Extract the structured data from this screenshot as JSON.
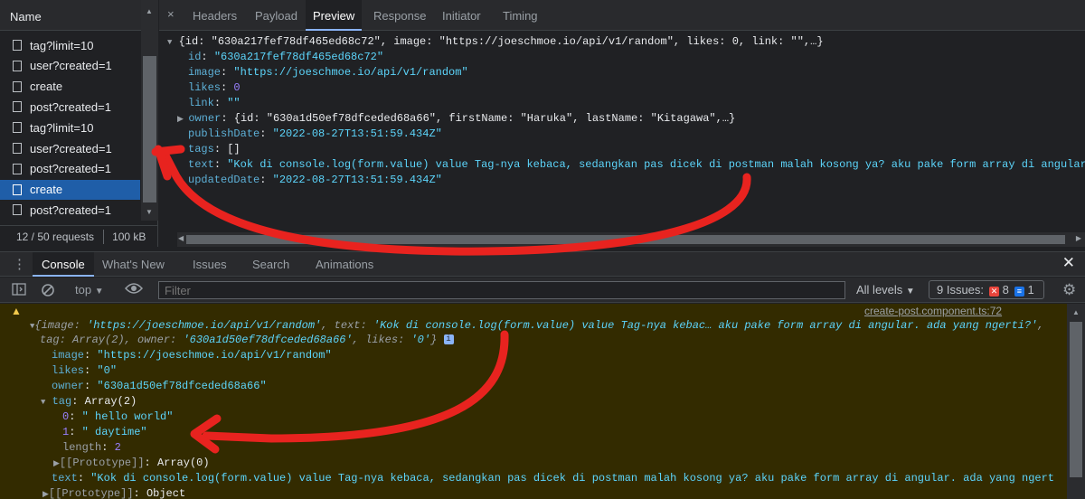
{
  "name_panel": {
    "header": "Name",
    "requests": [
      {
        "label": "tag?limit=10",
        "selected": false
      },
      {
        "label": "user?created=1",
        "selected": false
      },
      {
        "label": "create",
        "selected": false
      },
      {
        "label": "post?created=1",
        "selected": false
      },
      {
        "label": "tag?limit=10",
        "selected": false
      },
      {
        "label": "user?created=1",
        "selected": false
      },
      {
        "label": "post?created=1",
        "selected": false
      },
      {
        "label": "create",
        "selected": true
      },
      {
        "label": "post?created=1",
        "selected": false
      }
    ],
    "summary_requests": "12 / 50 requests",
    "summary_size": "100 kB"
  },
  "detail_tabs": {
    "close": "×",
    "tabs": [
      "Headers",
      "Payload",
      "Preview",
      "Response",
      "Initiator",
      "Timing"
    ],
    "active": "Preview"
  },
  "preview": {
    "summary": "{id: \"630a217fef78df465ed68c72\", image: \"https://joeschmoe.io/api/v1/random\", likes: 0, link: \"\",…}",
    "fields": [
      {
        "key": "id",
        "value": "\"630a217fef78df465ed68c72\"",
        "kind": "string"
      },
      {
        "key": "image",
        "value": "\"https://joeschmoe.io/api/v1/random\"",
        "kind": "string"
      },
      {
        "key": "likes",
        "value": "0",
        "kind": "number"
      },
      {
        "key": "link",
        "value": "\"\"",
        "kind": "string"
      },
      {
        "key": "owner",
        "value": "{id: \"630a1d50ef78dfceded68a66\", firstName: \"Haruka\", lastName: \"Kitagawa\",…}",
        "kind": "object"
      },
      {
        "key": "publishDate",
        "value": "\"2022-08-27T13:51:59.434Z\"",
        "kind": "string"
      },
      {
        "key": "tags",
        "value": "[]",
        "kind": "plain"
      },
      {
        "key": "text",
        "value": "\"Kok di console.log(form.value) value Tag-nya kebaca, sedangkan pas dicek di postman malah kosong ya? aku pake form array di angular.",
        "kind": "string"
      },
      {
        "key": "updatedDate",
        "value": "\"2022-08-27T13:51:59.434Z\"",
        "kind": "string"
      }
    ]
  },
  "drawer": {
    "tabs": [
      "Console",
      "What's New",
      "Issues",
      "Search",
      "Animations"
    ],
    "active": "Console",
    "close": "✕"
  },
  "console_toolbar": {
    "context": "top",
    "filter_placeholder": "Filter",
    "levels": "All levels",
    "issues_label": "9 Issues:",
    "issues_errors": "8",
    "issues_info": "1"
  },
  "console": {
    "source": "create-post.component.ts:72",
    "line1_a": "{image: ",
    "line1_image": "'https://joeschmoe.io/api/v1/random'",
    "line1_b": ", text: ",
    "line1_text": "'Kok di console.log(form.value) value Tag-nya kebac… aku pake form array di angular. ada yang ngerti?'",
    "line1_c": ",",
    "line2_a": "tag: Array(2), owner: ",
    "line2_owner": "'630a1d50ef78dfceded68a66'",
    "line2_b": ", likes: ",
    "line2_likes": "'0'",
    "line2_c": "}",
    "info_badge": "i",
    "image_key": "image",
    "image_val": "\"https://joeschmoe.io/api/v1/random\"",
    "likes_key": "likes",
    "likes_val": "\"0\"",
    "owner_key": "owner",
    "owner_val": "\"630a1d50ef78dfceded68a66\"",
    "tag_key": "tag",
    "tag_val": "Array(2)",
    "tag0_key": "0",
    "tag0_val": "\" hello world\"",
    "tag1_key": "1",
    "tag1_val": "\" daytime\"",
    "length_key": "length",
    "length_val": "2",
    "proto1_key": "[[Prototype]]",
    "proto1_val": "Array(0)",
    "text_key": "text",
    "text_val": "\"Kok di console.log(form.value) value Tag-nya kebaca, sedangkan pas dicek di postman malah kosong ya? aku pake form array di angular. ada yang ngert",
    "proto2_key": "[[Prototype]]",
    "proto2_val": "Object"
  },
  "annotation_color": "#e8231f"
}
